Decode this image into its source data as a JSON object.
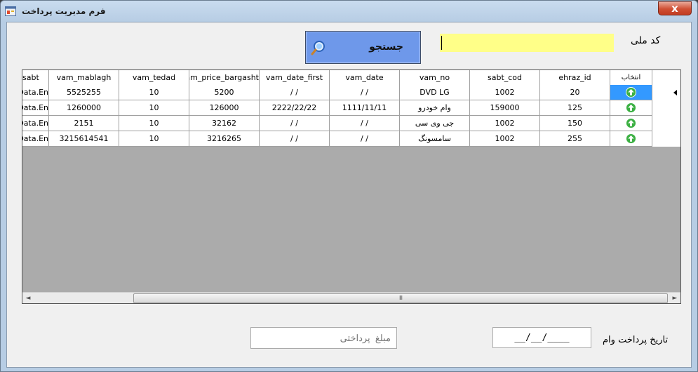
{
  "window": {
    "title": "فرم مدیریت پرداخت",
    "close_label": "x"
  },
  "search": {
    "code_label": "کد ملی",
    "code_value": "",
    "button_label": "جستجو"
  },
  "grid": {
    "columns": [
      "انتخاب",
      "ehraz_id",
      "sabt_cod",
      "vam_no",
      "vam_date",
      "vam_date_first",
      "vam_price_bargasht",
      "vam_tedad",
      "vam_mablagh",
      "sabt"
    ],
    "rows": [
      {
        "ehraz_id": "20",
        "sabt_cod": "1002",
        "vam_no": "DVD LG",
        "vam_date": "/ /",
        "vam_date_first": "/ /",
        "vam_price_bargasht": "5200",
        "vam_tedad": "10",
        "vam_mablagh": "5525255",
        "sabt": "Data.En"
      },
      {
        "ehraz_id": "125",
        "sabt_cod": "159000",
        "vam_no": "وام خودرو",
        "vam_date": "1111/11/11",
        "vam_date_first": "2222/22/22",
        "vam_price_bargasht": "126000",
        "vam_tedad": "10",
        "vam_mablagh": "1260000",
        "sabt": "Data.En"
      },
      {
        "ehraz_id": "150",
        "sabt_cod": "1002",
        "vam_no": "جی وی سی",
        "vam_date": "/ /",
        "vam_date_first": "/ /",
        "vam_price_bargasht": "32162",
        "vam_tedad": "10",
        "vam_mablagh": "2151",
        "sabt": "Data.En"
      },
      {
        "ehraz_id": "255",
        "sabt_cod": "1002",
        "vam_no": "سامسونگ",
        "vam_date": "/ /",
        "vam_date_first": "/ /",
        "vam_price_bargasht": "3216265",
        "vam_tedad": "10",
        "vam_mablagh": "3215614541",
        "sabt": "Data.En"
      }
    ],
    "select_icon": "up-arrow-icon",
    "scroll_left": "◄",
    "scroll_right": "►",
    "scroll_grip": "III"
  },
  "footer": {
    "date_label": "تاریخ  پرداخت وام",
    "date_value": "__/__/____",
    "amount_placeholder": "مبلغ  پرداختی"
  },
  "colors": {
    "accent": "#6e98ea",
    "code_field": "#ffff88",
    "selected_cell": "#3399ff",
    "select_icon": "#3cb043",
    "close_button": "#cf4f33"
  }
}
